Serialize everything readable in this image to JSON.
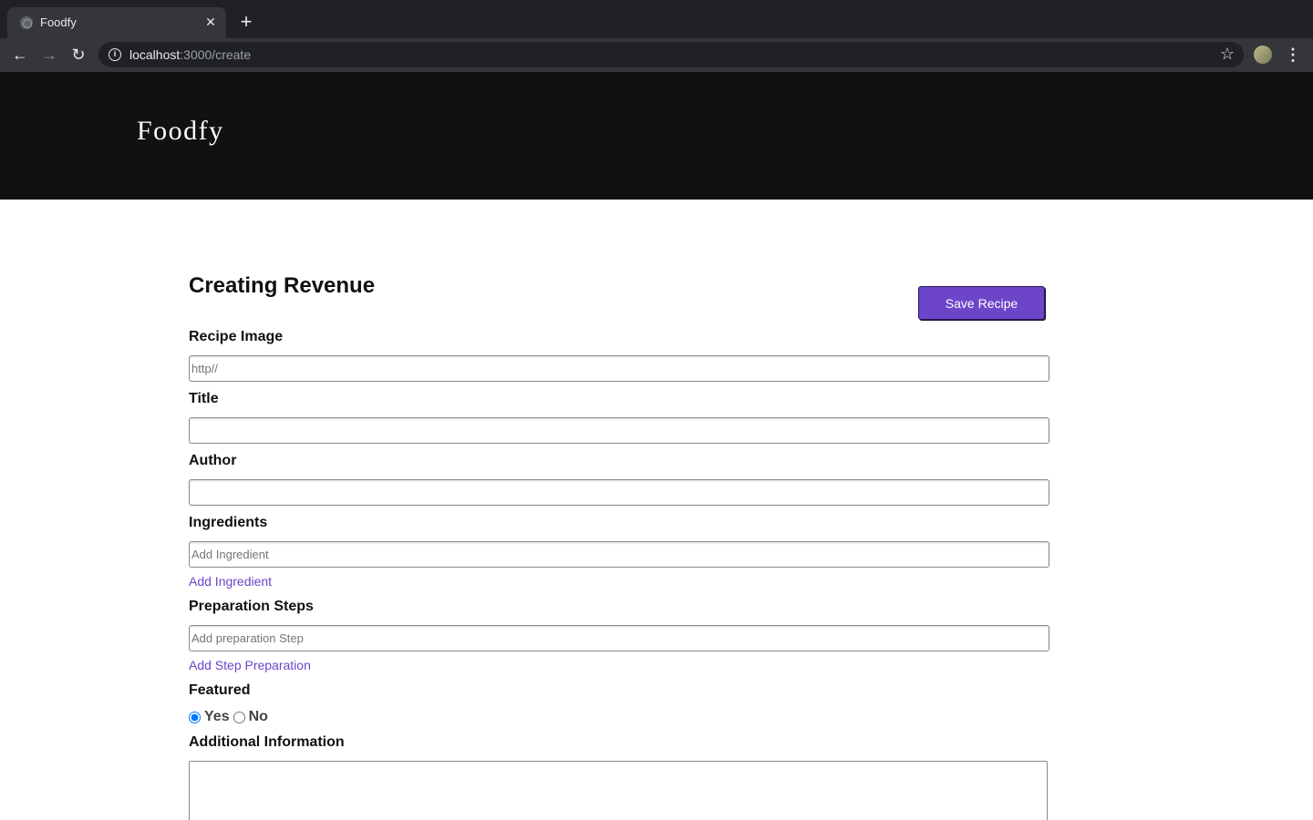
{
  "browser": {
    "tab_title": "Foodfy",
    "tab_close": "✕",
    "new_tab": "+",
    "url_host": "localhost",
    "url_path": ":3000/create"
  },
  "header": {
    "logo": "Foodfy"
  },
  "form": {
    "title": "Creating Revenue",
    "save_label": "Save Recipe",
    "image_label": "Recipe Image",
    "image_placeholder": "http//",
    "title_label": "Title",
    "author_label": "Author",
    "ingredients_label": "Ingredients",
    "ingredient_placeholder": "Add Ingredient",
    "add_ingredient": "Add Ingredient",
    "steps_label": "Preparation Steps",
    "step_placeholder": "Add preparation Step",
    "add_step": "Add Step Preparation",
    "featured_label": "Featured",
    "featured_options": [
      "Yes",
      "No"
    ],
    "featured_selected": "Yes",
    "additional_label": "Additional Information"
  },
  "colors": {
    "accent": "#6c45c8",
    "header_bg": "#111111"
  }
}
